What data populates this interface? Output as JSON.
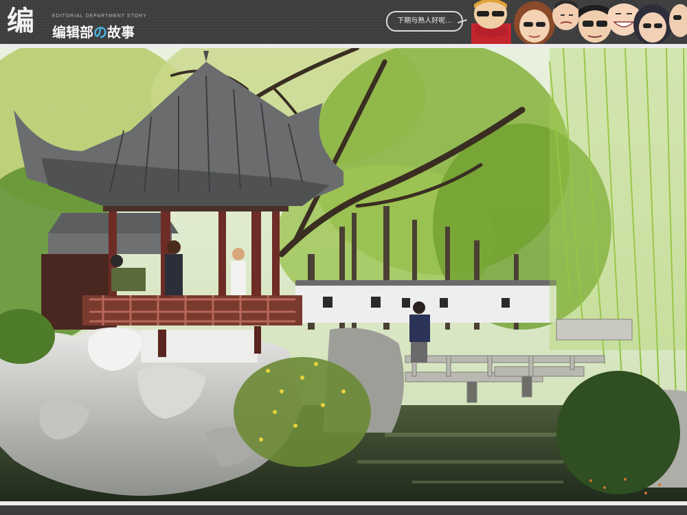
{
  "header": {
    "logo_glyph": "编",
    "brand_subtitle": "EDITORIAL DEPARTMENT STORY",
    "brand_title_before": "编辑部",
    "brand_title_no": "の",
    "brand_title_after": "故事",
    "speech_bubble": "下期与熟人好呢...",
    "avatars_icon": "cartoon-faces-icon"
  },
  "photo": {
    "scene": "garden-pavilion-photo-icon"
  },
  "colors": {
    "header_bg": "#3d3d3d",
    "accent_no": "#4db6e8",
    "rule": "#ececec"
  }
}
